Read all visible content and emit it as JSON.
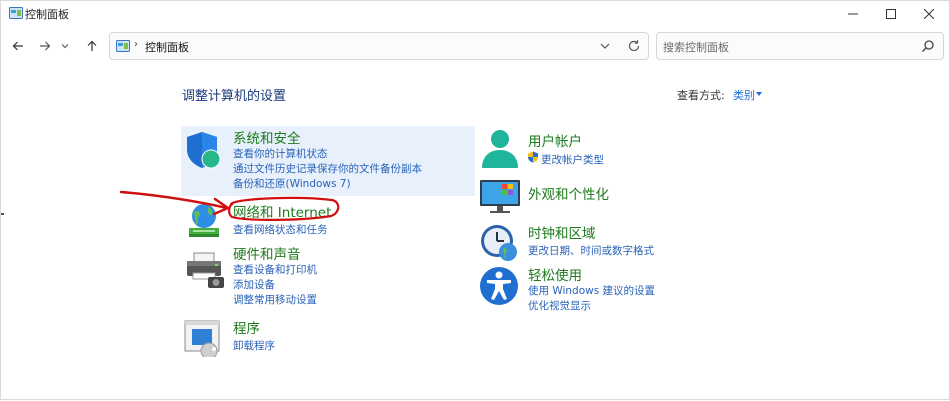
{
  "window": {
    "title": "控制面板",
    "controls": {
      "minimize": "—",
      "maximize": "☐",
      "close": "✕"
    }
  },
  "nav": {
    "address_path": "控制面板",
    "search_placeholder": "搜索控制面板"
  },
  "header": {
    "title": "调整计算机的设置",
    "view_by_label": "查看方式:",
    "view_by_value": "类别"
  },
  "categories": {
    "system_security": {
      "title": "系统和安全",
      "links": [
        "查看你的计算机状态",
        "通过文件历史记录保存你的文件备份副本",
        "备份和还原(Windows 7)"
      ],
      "highlighted": true
    },
    "network": {
      "title": "网络和 Internet",
      "links": [
        "查看网络状态和任务"
      ]
    },
    "hardware": {
      "title": "硬件和声音",
      "links": [
        "查看设备和打印机",
        "添加设备",
        "调整常用移动设置"
      ]
    },
    "programs": {
      "title": "程序",
      "links": [
        "卸载程序"
      ]
    },
    "user_accounts": {
      "title": "用户帐户",
      "links": [
        "更改帐户类型"
      ]
    },
    "appearance": {
      "title": "外观和个性化",
      "links": []
    },
    "clock_region": {
      "title": "时钟和区域",
      "links": [
        "更改日期、时间或数字格式"
      ]
    },
    "ease_access": {
      "title": "轻松使用",
      "links": [
        "使用 Windows 建议的设置",
        "优化视觉显示"
      ]
    }
  },
  "colors": {
    "category_title": "#1d7a1d",
    "link": "#2a62b8",
    "highlight": "#e8f1fb",
    "annotation": "#d01010"
  }
}
